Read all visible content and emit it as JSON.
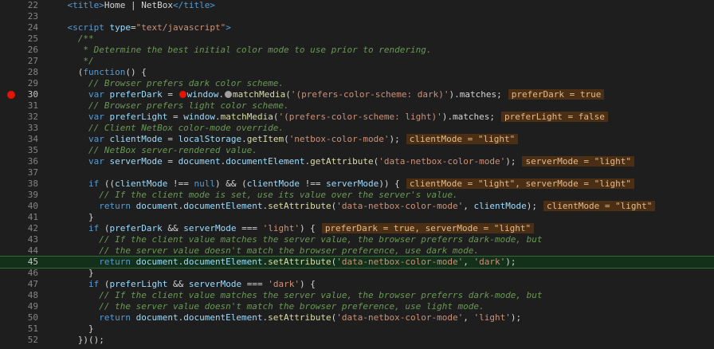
{
  "editor": {
    "lines": [
      {
        "num": "22",
        "tokens": [
          {
            "t": "    ",
            "c": "txt"
          },
          {
            "t": "<title>",
            "c": "tag"
          },
          {
            "t": "Home | NetBox",
            "c": "txt"
          },
          {
            "t": "</title>",
            "c": "tag"
          }
        ]
      },
      {
        "num": "23",
        "tokens": []
      },
      {
        "num": "24",
        "tokens": [
          {
            "t": "    ",
            "c": "txt"
          },
          {
            "t": "<script ",
            "c": "tag"
          },
          {
            "t": "type",
            "c": "attr"
          },
          {
            "t": "=",
            "c": "txt"
          },
          {
            "t": "\"text/javascript\"",
            "c": "str"
          },
          {
            "t": ">",
            "c": "tag"
          }
        ]
      },
      {
        "num": "25",
        "tokens": [
          {
            "t": "      /**",
            "c": "com"
          }
        ]
      },
      {
        "num": "26",
        "tokens": [
          {
            "t": "       * Determine the best initial color mode to use prior to rendering.",
            "c": "com"
          }
        ]
      },
      {
        "num": "27",
        "tokens": [
          {
            "t": "       */",
            "c": "com"
          }
        ]
      },
      {
        "num": "28",
        "tokens": [
          {
            "t": "      (",
            "c": "txt"
          },
          {
            "t": "function",
            "c": "kw"
          },
          {
            "t": "() {",
            "c": "txt"
          }
        ]
      },
      {
        "num": "29",
        "tokens": [
          {
            "t": "        // Browser prefers dark color scheme.",
            "c": "com"
          }
        ]
      },
      {
        "num": "30",
        "breakpoint": true,
        "tokens": [
          {
            "t": "        ",
            "c": "txt"
          },
          {
            "t": "var ",
            "c": "kw"
          },
          {
            "t": "preferDark",
            "c": "var"
          },
          {
            "t": " = ",
            "c": "txt"
          },
          {
            "t": "",
            "c": "bp"
          },
          {
            "t": "window",
            "c": "var"
          },
          {
            "t": ".",
            "c": "txt"
          },
          {
            "t": "",
            "c": "dot"
          },
          {
            "t": "matchMedia",
            "c": "fn"
          },
          {
            "t": "(",
            "c": "txt"
          },
          {
            "t": "'(prefers-color-scheme: dark)'",
            "c": "str"
          },
          {
            "t": ").matches;",
            "c": "txt"
          }
        ],
        "hint": "preferDark = true"
      },
      {
        "num": "31",
        "tokens": [
          {
            "t": "        // Browser prefers light color scheme.",
            "c": "com"
          }
        ]
      },
      {
        "num": "32",
        "tokens": [
          {
            "t": "        ",
            "c": "txt"
          },
          {
            "t": "var ",
            "c": "kw"
          },
          {
            "t": "preferLight",
            "c": "var"
          },
          {
            "t": " = ",
            "c": "txt"
          },
          {
            "t": "window",
            "c": "var"
          },
          {
            "t": ".",
            "c": "txt"
          },
          {
            "t": "matchMedia",
            "c": "fn"
          },
          {
            "t": "(",
            "c": "txt"
          },
          {
            "t": "'(prefers-color-scheme: light)'",
            "c": "str"
          },
          {
            "t": ").matches;",
            "c": "txt"
          }
        ],
        "hint": "preferLight = false"
      },
      {
        "num": "33",
        "tokens": [
          {
            "t": "        // Client NetBox color-mode override.",
            "c": "com"
          }
        ]
      },
      {
        "num": "34",
        "tokens": [
          {
            "t": "        ",
            "c": "txt"
          },
          {
            "t": "var ",
            "c": "kw"
          },
          {
            "t": "clientMode",
            "c": "var"
          },
          {
            "t": " = ",
            "c": "txt"
          },
          {
            "t": "localStorage",
            "c": "var"
          },
          {
            "t": ".",
            "c": "txt"
          },
          {
            "t": "getItem",
            "c": "fn"
          },
          {
            "t": "(",
            "c": "txt"
          },
          {
            "t": "'netbox-color-mode'",
            "c": "str"
          },
          {
            "t": ");",
            "c": "txt"
          }
        ],
        "hint": "clientMode = \"light\""
      },
      {
        "num": "35",
        "tokens": [
          {
            "t": "        // NetBox server-rendered value.",
            "c": "com"
          }
        ]
      },
      {
        "num": "36",
        "tokens": [
          {
            "t": "        ",
            "c": "txt"
          },
          {
            "t": "var ",
            "c": "kw"
          },
          {
            "t": "serverMode",
            "c": "var"
          },
          {
            "t": " = ",
            "c": "txt"
          },
          {
            "t": "document",
            "c": "var"
          },
          {
            "t": ".",
            "c": "txt"
          },
          {
            "t": "documentElement",
            "c": "var"
          },
          {
            "t": ".",
            "c": "txt"
          },
          {
            "t": "getAttribute",
            "c": "fn"
          },
          {
            "t": "(",
            "c": "txt"
          },
          {
            "t": "'data-netbox-color-mode'",
            "c": "str"
          },
          {
            "t": ");",
            "c": "txt"
          }
        ],
        "hint": "serverMode = \"light\""
      },
      {
        "num": "37",
        "tokens": []
      },
      {
        "num": "38",
        "tokens": [
          {
            "t": "        ",
            "c": "txt"
          },
          {
            "t": "if ",
            "c": "kw"
          },
          {
            "t": "((",
            "c": "txt"
          },
          {
            "t": "clientMode",
            "c": "var"
          },
          {
            "t": " !== ",
            "c": "txt"
          },
          {
            "t": "null",
            "c": "kw"
          },
          {
            "t": ") && (",
            "c": "txt"
          },
          {
            "t": "clientMode",
            "c": "var"
          },
          {
            "t": " !== ",
            "c": "txt"
          },
          {
            "t": "serverMode",
            "c": "var"
          },
          {
            "t": ")) {",
            "c": "txt"
          }
        ],
        "hint": "clientMode = \"light\", serverMode = \"light\""
      },
      {
        "num": "39",
        "tokens": [
          {
            "t": "          // If the client mode is set, use its value over the server's value.",
            "c": "com"
          }
        ]
      },
      {
        "num": "40",
        "tokens": [
          {
            "t": "          ",
            "c": "txt"
          },
          {
            "t": "return ",
            "c": "kw"
          },
          {
            "t": "document",
            "c": "var"
          },
          {
            "t": ".",
            "c": "txt"
          },
          {
            "t": "documentElement",
            "c": "var"
          },
          {
            "t": ".",
            "c": "txt"
          },
          {
            "t": "setAttribute",
            "c": "fn"
          },
          {
            "t": "(",
            "c": "txt"
          },
          {
            "t": "'data-netbox-color-mode'",
            "c": "str"
          },
          {
            "t": ", ",
            "c": "txt"
          },
          {
            "t": "clientMode",
            "c": "var"
          },
          {
            "t": ");",
            "c": "txt"
          }
        ],
        "hint": "clientMode = \"light\""
      },
      {
        "num": "41",
        "tokens": [
          {
            "t": "        }",
            "c": "txt"
          }
        ]
      },
      {
        "num": "42",
        "tokens": [
          {
            "t": "        ",
            "c": "txt"
          },
          {
            "t": "if ",
            "c": "kw"
          },
          {
            "t": "(",
            "c": "txt"
          },
          {
            "t": "preferDark",
            "c": "var"
          },
          {
            "t": " && ",
            "c": "txt"
          },
          {
            "t": "serverMode",
            "c": "var"
          },
          {
            "t": " === ",
            "c": "txt"
          },
          {
            "t": "'light'",
            "c": "str"
          },
          {
            "t": ") {",
            "c": "txt"
          }
        ],
        "hint": "preferDark = true, serverMode = \"light\""
      },
      {
        "num": "43",
        "tokens": [
          {
            "t": "          // If the client value matches the server value, the browser preferrs dark-mode, but",
            "c": "com"
          }
        ]
      },
      {
        "num": "44",
        "tokens": [
          {
            "t": "          // the server value doesn't match the browser preference, use dark mode.",
            "c": "com"
          }
        ]
      },
      {
        "num": "45",
        "current": true,
        "tokens": [
          {
            "t": "          ",
            "c": "txt"
          },
          {
            "t": "return ",
            "c": "kw"
          },
          {
            "t": "document",
            "c": "var"
          },
          {
            "t": ".",
            "c": "txt"
          },
          {
            "t": "documentElement",
            "c": "var"
          },
          {
            "t": ".",
            "c": "txt"
          },
          {
            "t": "setAttribute",
            "c": "fn"
          },
          {
            "t": "(",
            "c": "txt"
          },
          {
            "t": "'data-netbox-color-mode'",
            "c": "str"
          },
          {
            "t": ", ",
            "c": "txt"
          },
          {
            "t": "'dark'",
            "c": "str"
          },
          {
            "t": ");",
            "c": "txt"
          }
        ]
      },
      {
        "num": "46",
        "tokens": [
          {
            "t": "        }",
            "c": "txt"
          }
        ]
      },
      {
        "num": "47",
        "tokens": [
          {
            "t": "        ",
            "c": "txt"
          },
          {
            "t": "if ",
            "c": "kw"
          },
          {
            "t": "(",
            "c": "txt"
          },
          {
            "t": "preferLight",
            "c": "var"
          },
          {
            "t": " && ",
            "c": "txt"
          },
          {
            "t": "serverMode",
            "c": "var"
          },
          {
            "t": " === ",
            "c": "txt"
          },
          {
            "t": "'dark'",
            "c": "str"
          },
          {
            "t": ") {",
            "c": "txt"
          }
        ]
      },
      {
        "num": "48",
        "tokens": [
          {
            "t": "          // If the client value matches the server value, the browser preferrs dark-mode, but",
            "c": "com"
          }
        ]
      },
      {
        "num": "49",
        "tokens": [
          {
            "t": "          // the server value doesn't match the browser preference, use light mode.",
            "c": "com"
          }
        ]
      },
      {
        "num": "50",
        "tokens": [
          {
            "t": "          ",
            "c": "txt"
          },
          {
            "t": "return ",
            "c": "kw"
          },
          {
            "t": "document",
            "c": "var"
          },
          {
            "t": ".",
            "c": "txt"
          },
          {
            "t": "documentElement",
            "c": "var"
          },
          {
            "t": ".",
            "c": "txt"
          },
          {
            "t": "setAttribute",
            "c": "fn"
          },
          {
            "t": "(",
            "c": "txt"
          },
          {
            "t": "'data-netbox-color-mode'",
            "c": "str"
          },
          {
            "t": ", ",
            "c": "txt"
          },
          {
            "t": "'light'",
            "c": "str"
          },
          {
            "t": ");",
            "c": "txt"
          }
        ]
      },
      {
        "num": "51",
        "tokens": [
          {
            "t": "        }",
            "c": "txt"
          }
        ]
      },
      {
        "num": "52",
        "tokens": [
          {
            "t": "      })();",
            "c": "txt"
          }
        ]
      }
    ]
  }
}
